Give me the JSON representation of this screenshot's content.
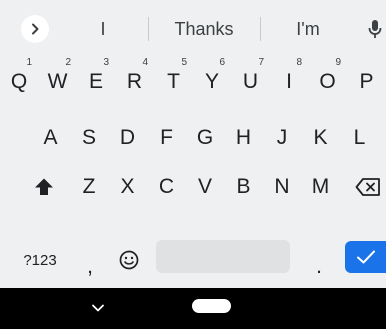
{
  "suggestion_strip": {
    "expand_icon": "chevron-right-icon",
    "suggestions": [
      "I",
      "Thanks",
      "I'm"
    ],
    "mic_icon": "microphone-icon"
  },
  "keyboard": {
    "row1": [
      {
        "letter": "Q",
        "hint": "1"
      },
      {
        "letter": "W",
        "hint": "2"
      },
      {
        "letter": "E",
        "hint": "3"
      },
      {
        "letter": "R",
        "hint": "4"
      },
      {
        "letter": "T",
        "hint": "5"
      },
      {
        "letter": "Y",
        "hint": "6"
      },
      {
        "letter": "U",
        "hint": "7"
      },
      {
        "letter": "I",
        "hint": "8"
      },
      {
        "letter": "O",
        "hint": "9"
      },
      {
        "letter": "P",
        "hint": ""
      }
    ],
    "row2": [
      "A",
      "S",
      "D",
      "F",
      "G",
      "H",
      "J",
      "K",
      "L"
    ],
    "row3": [
      "Z",
      "X",
      "C",
      "V",
      "B",
      "N",
      "M"
    ],
    "symbols_label": "?123",
    "comma_label": ",",
    "period_label": ".",
    "shift_icon": "shift-arrow-icon",
    "backspace_icon": "backspace-icon",
    "emoji_icon": "emoji-icon",
    "enter_icon": "checkmark-icon"
  },
  "navbar": {
    "back_icon": "chevron-down-icon",
    "home_icon": "home-pill-icon"
  },
  "colors": {
    "keyboard_bg": "#eef0f1",
    "enter_accent": "#1a73e8",
    "navbar_bg": "#000000"
  }
}
